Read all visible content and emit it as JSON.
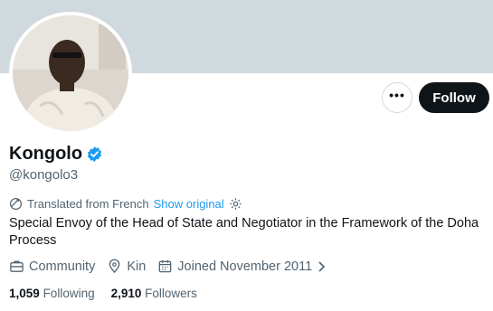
{
  "profile": {
    "name": "Kongolo",
    "handle": "@kongolo3",
    "translated_label": "Translated from French",
    "show_original": "Show original",
    "bio": "Special Envoy of the Head of State and Negotiator in the Framework of the Doha Process",
    "category": "Community",
    "location": "Kin",
    "joined": "Joined November 2011",
    "following_count": "1,059",
    "following_label": "Following",
    "followers_count": "2,910",
    "followers_label": "Followers"
  },
  "actions": {
    "more_label": "•••",
    "follow_label": "Follow"
  },
  "icons": [
    "verified-badge-icon",
    "translate-icon",
    "gear-icon",
    "briefcase-icon",
    "location-pin-icon",
    "calendar-icon",
    "chevron-right-icon",
    "more-icon"
  ],
  "colors": {
    "banner": "#cfd9de",
    "accent": "#1d9bf0",
    "follow_button": "#0f1419",
    "secondary_text": "#536471"
  }
}
